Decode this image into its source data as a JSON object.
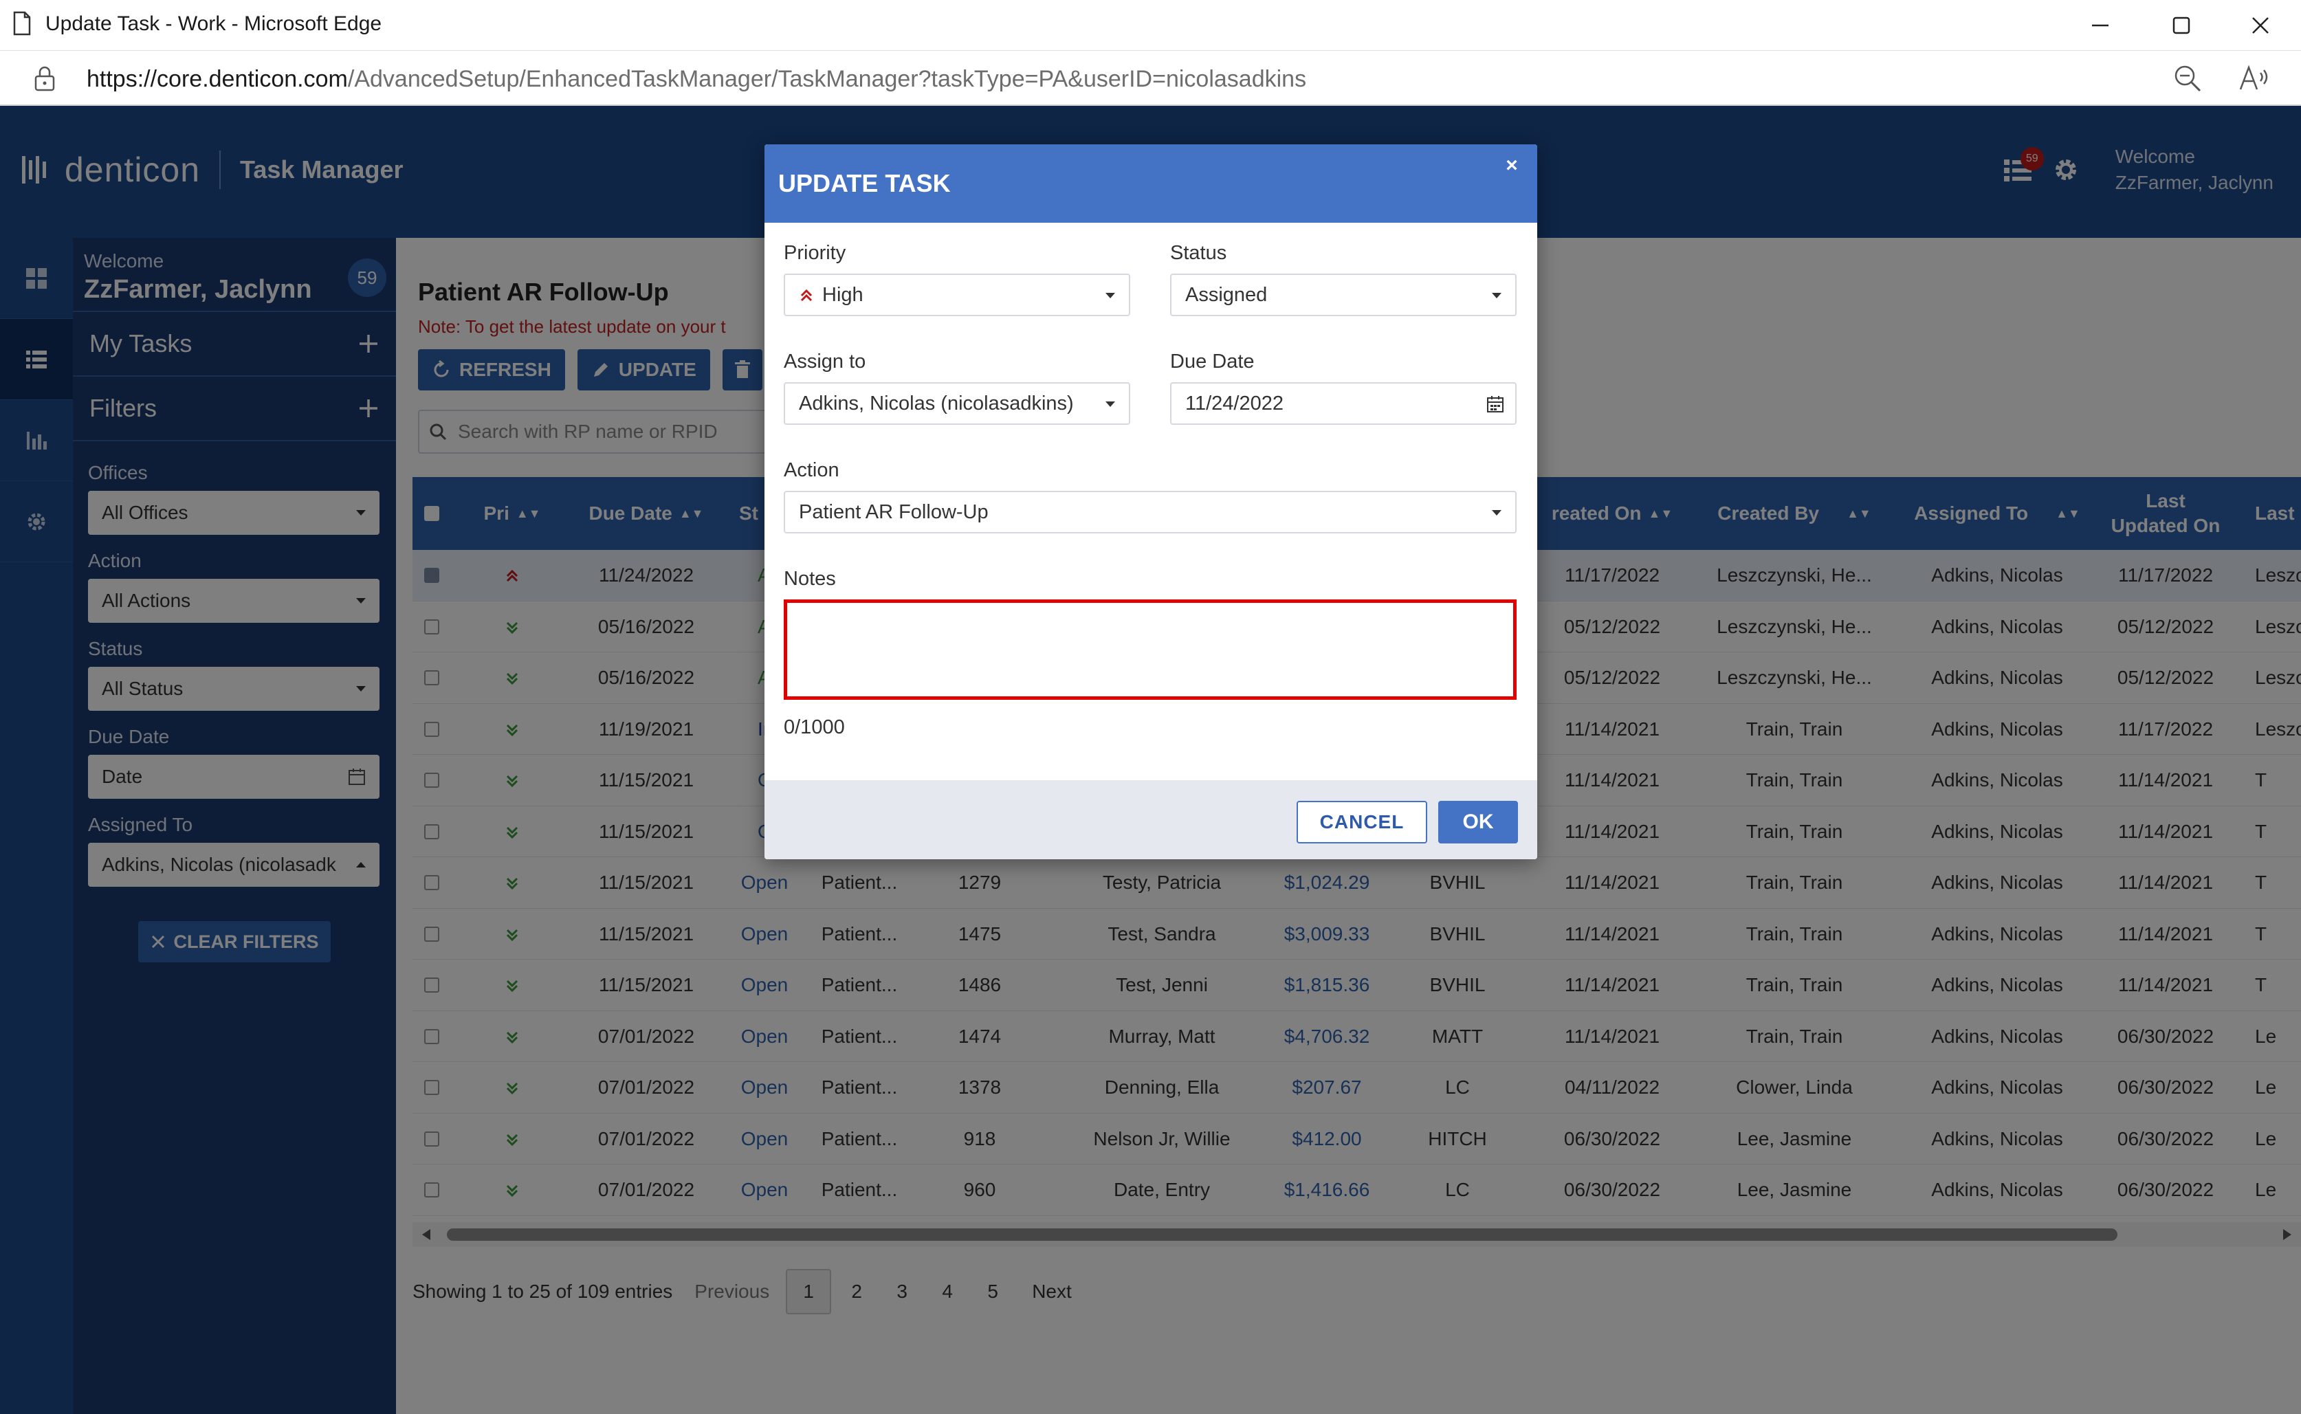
{
  "window": {
    "title": "Update Task - Work - Microsoft Edge",
    "url_host": "https://core.denticon.com",
    "url_path": "/AdvancedSetup/EnhancedTaskManager/TaskManager?taskType=PA&userID=nicolasadkins"
  },
  "app": {
    "brand": "denticon",
    "module": "Task Manager",
    "welcome_line1": "Welcome",
    "welcome_line2": "ZzFarmer, Jaclynn",
    "notification_count": "59",
    "accent_color": "#1d4a8c"
  },
  "sidebar": {
    "welcome": "Welcome",
    "user": "ZzFarmer, Jaclynn",
    "task_count": "59",
    "my_tasks": "My Tasks",
    "filters": "Filters",
    "offices_label": "Offices",
    "offices_value": "All Offices",
    "action_label": "Action",
    "action_value": "All Actions",
    "status_label": "Status",
    "status_value": "All Status",
    "due_label": "Due Date",
    "due_value": "Date",
    "assigned_label": "Assigned To",
    "assigned_value": "Adkins, Nicolas (nicolasadk",
    "clear_filters": "CLEAR FILTERS"
  },
  "main": {
    "title": "Patient AR Follow-Up",
    "note": "Note: To get the latest update on your t",
    "refresh": "REFRESH",
    "update": "UPDATE",
    "search_placeholder": "Search with RP name or RPID"
  },
  "grid": {
    "headers": {
      "pri": "Pri",
      "due": "Due Date",
      "status": "St",
      "created_on": "reated On",
      "created_by": "Created By",
      "assigned_to": "Assigned To",
      "last_updated_1": "Last",
      "last_updated_2": "Updated On",
      "last_by": "Last"
    },
    "rows": [
      {
        "sel": true,
        "pri": "high",
        "due": "11/24/2022",
        "status": "Ass",
        "stype": "asg",
        "action": "",
        "rpid": "",
        "name": "",
        "amt": "",
        "office": "",
        "created": "11/17/2022",
        "createdby": "Leszczynski, He...",
        "assigned": "Adkins, Nicolas",
        "updated": "11/17/2022",
        "lastby": "Leszc"
      },
      {
        "sel": false,
        "pri": "low",
        "due": "05/16/2022",
        "status": "Ass",
        "stype": "asg",
        "action": "",
        "rpid": "",
        "name": "",
        "amt": "",
        "office": "",
        "created": "05/12/2022",
        "createdby": "Leszczynski, He...",
        "assigned": "Adkins, Nicolas",
        "updated": "05/12/2022",
        "lastby": "Leszc"
      },
      {
        "sel": false,
        "pri": "low",
        "due": "05/16/2022",
        "status": "Ass",
        "stype": "asg",
        "action": "",
        "rpid": "",
        "name": "",
        "amt": "",
        "office": "",
        "created": "05/12/2022",
        "createdby": "Leszczynski, He...",
        "assigned": "Adkins, Nicolas",
        "updated": "05/12/2022",
        "lastby": "Leszc"
      },
      {
        "sel": false,
        "pri": "low",
        "due": "11/19/2021",
        "status": "In p",
        "stype": "inp",
        "action": "",
        "rpid": "",
        "name": "",
        "amt": "",
        "office": "",
        "created": "11/14/2021",
        "createdby": "Train, Train",
        "assigned": "Adkins, Nicolas",
        "updated": "11/17/2022",
        "lastby": "Leszc"
      },
      {
        "sel": false,
        "pri": "low",
        "due": "11/15/2021",
        "status": "O",
        "stype": "open",
        "action": "",
        "rpid": "",
        "name": "",
        "amt": "",
        "office": "",
        "created": "11/14/2021",
        "createdby": "Train, Train",
        "assigned": "Adkins, Nicolas",
        "updated": "11/14/2021",
        "lastby": "T"
      },
      {
        "sel": false,
        "pri": "low",
        "due": "11/15/2021",
        "status": "O",
        "stype": "open",
        "action": "",
        "rpid": "",
        "name": "",
        "amt": "",
        "office": "",
        "created": "11/14/2021",
        "createdby": "Train, Train",
        "assigned": "Adkins, Nicolas",
        "updated": "11/14/2021",
        "lastby": "T"
      },
      {
        "sel": false,
        "pri": "low",
        "due": "11/15/2021",
        "status": "Open",
        "stype": "open",
        "action": "Patient...",
        "rpid": "1279",
        "name": "Testy, Patricia",
        "amt": "$1,024.29",
        "office": "BVHIL",
        "created": "11/14/2021",
        "createdby": "Train, Train",
        "assigned": "Adkins, Nicolas",
        "updated": "11/14/2021",
        "lastby": "T"
      },
      {
        "sel": false,
        "pri": "low",
        "due": "11/15/2021",
        "status": "Open",
        "stype": "open",
        "action": "Patient...",
        "rpid": "1475",
        "name": "Test, Sandra",
        "amt": "$3,009.33",
        "office": "BVHIL",
        "created": "11/14/2021",
        "createdby": "Train, Train",
        "assigned": "Adkins, Nicolas",
        "updated": "11/14/2021",
        "lastby": "T"
      },
      {
        "sel": false,
        "pri": "low",
        "due": "11/15/2021",
        "status": "Open",
        "stype": "open",
        "action": "Patient...",
        "rpid": "1486",
        "name": "Test, Jenni",
        "amt": "$1,815.36",
        "office": "BVHIL",
        "created": "11/14/2021",
        "createdby": "Train, Train",
        "assigned": "Adkins, Nicolas",
        "updated": "11/14/2021",
        "lastby": "T"
      },
      {
        "sel": false,
        "pri": "low",
        "due": "07/01/2022",
        "status": "Open",
        "stype": "open",
        "action": "Patient...",
        "rpid": "1474",
        "name": "Murray, Matt",
        "amt": "$4,706.32",
        "office": "MATT",
        "created": "11/14/2021",
        "createdby": "Train, Train",
        "assigned": "Adkins, Nicolas",
        "updated": "06/30/2022",
        "lastby": "Le"
      },
      {
        "sel": false,
        "pri": "low",
        "due": "07/01/2022",
        "status": "Open",
        "stype": "open",
        "action": "Patient...",
        "rpid": "1378",
        "name": "Denning, Ella",
        "amt": "$207.67",
        "office": "LC",
        "created": "04/11/2022",
        "createdby": "Clower, Linda",
        "assigned": "Adkins, Nicolas",
        "updated": "06/30/2022",
        "lastby": "Le"
      },
      {
        "sel": false,
        "pri": "low",
        "due": "07/01/2022",
        "status": "Open",
        "stype": "open",
        "action": "Patient...",
        "rpid": "918",
        "name": "Nelson Jr, Willie",
        "amt": "$412.00",
        "office": "HITCH",
        "created": "06/30/2022",
        "createdby": "Lee, Jasmine",
        "assigned": "Adkins, Nicolas",
        "updated": "06/30/2022",
        "lastby": "Le"
      },
      {
        "sel": false,
        "pri": "low",
        "due": "07/01/2022",
        "status": "Open",
        "stype": "open",
        "action": "Patient...",
        "rpid": "960",
        "name": "Date, Entry",
        "amt": "$1,416.66",
        "office": "LC",
        "created": "06/30/2022",
        "createdby": "Lee, Jasmine",
        "assigned": "Adkins, Nicolas",
        "updated": "06/30/2022",
        "lastby": "Le"
      }
    ]
  },
  "pager": {
    "summary": "Showing 1 to 25 of 109 entries",
    "previous": "Previous",
    "pages": [
      "1",
      "2",
      "3",
      "4",
      "5"
    ],
    "next": "Next"
  },
  "modal": {
    "title": "UPDATE TASK",
    "close": "×",
    "priority_label": "Priority",
    "priority_value": "High",
    "status_label": "Status",
    "status_value": "Assigned",
    "assign_label": "Assign to",
    "assign_value": "Adkins, Nicolas (nicolasadkins)",
    "due_label": "Due Date",
    "due_value": "11/24/2022",
    "action_label": "Action",
    "action_value": "Patient AR Follow-Up",
    "notes_label": "Notes",
    "notes_value": "",
    "notes_counter": "0/1000",
    "cancel": "CANCEL",
    "ok": "OK"
  }
}
